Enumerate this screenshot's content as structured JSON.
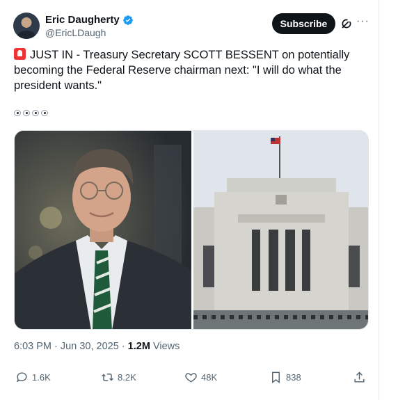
{
  "author": {
    "name": "Eric Daugherty",
    "handle": "@EricLDaugh"
  },
  "header": {
    "subscribe_label": "Subscribe",
    "more_label": "···"
  },
  "tweet": {
    "text": "JUST IN - Treasury Secretary SCOTT BESSENT on potentially becoming the Federal Reserve chairman next: \"I will do what the president wants.\""
  },
  "meta": {
    "time": "6:03 PM",
    "separator": "·",
    "date": "Jun 30, 2025",
    "views_count": "1.2M",
    "views_label": "Views"
  },
  "actions": {
    "replies": "1.6K",
    "reposts": "8.2K",
    "likes": "48K",
    "bookmarks": "838"
  },
  "colors": {
    "verified": "#1d9bf0",
    "text_secondary": "#536471",
    "button_bg": "#0f1419"
  }
}
